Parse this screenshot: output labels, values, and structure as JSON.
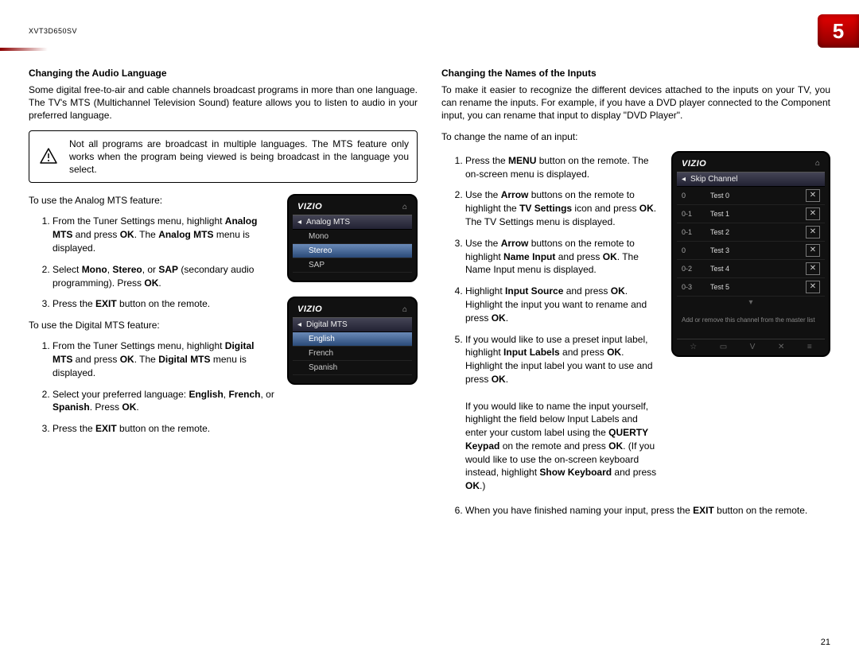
{
  "header": {
    "model": "XVT3D650SV",
    "chapter_number": "5",
    "page_number": "21"
  },
  "left": {
    "h": "Changing the Audio Language",
    "intro": "Some digital free-to-air and cable channels broadcast programs in more than one language. The TV's MTS (Multichannel Television Sound) feature allows you to listen to audio in your preferred language.",
    "note": "Not all programs are broadcast in multiple languages. The MTS feature only works when the program being viewed is being broadcast in the language you select.",
    "analog_lead": "To use the Analog MTS feature:",
    "analog_steps": [
      "From the Tuner Settings menu, highlight <b>Analog MTS</b> and press <b>OK</b>. The <b>Analog MTS</b> menu is displayed.",
      "Select <b>Mono</b>, <b>Stereo</b>, or <b>SAP</b> (secondary audio programming). Press <b>OK</b>.",
      "Press the <b>EXIT</b> button on the remote."
    ],
    "digital_lead": "To use the Digital MTS feature:",
    "digital_steps": [
      "From the Tuner Settings menu, highlight <b>Digital MTS</b> and press <b>OK</b>. The <b>Digital MTS</b> menu is displayed.",
      "Select your preferred language: <b>English</b>, <b>French</b>, or <b>Spanish</b>. Press <b>OK</b>.",
      "Press the <b>EXIT</b> button on the remote."
    ],
    "ss1": {
      "brand": "VIZIO",
      "title": "Analog MTS",
      "items": [
        "Mono",
        "Stereo",
        "SAP"
      ],
      "highlight_index": 1
    },
    "ss2": {
      "brand": "VIZIO",
      "title": "Digital MTS",
      "items": [
        "English",
        "French",
        "Spanish"
      ],
      "highlight_index": 0
    }
  },
  "right": {
    "h": "Changing the Names of the Inputs",
    "intro": "To make it easier to recognize the different devices attached to the inputs on your TV, you can rename the inputs. For example, if you have a DVD player connected to the Component input, you can rename that input to display \"DVD Player\".",
    "lead": "To change the name of an input:",
    "steps": [
      "Press the <b>MENU</b> button on the remote. The on-screen menu is displayed.",
      "Use the <b>Arrow</b> buttons on the remote to highlight the <b>TV Settings</b> icon and press <b>OK</b>. The TV Settings menu is displayed.",
      "Use the <b>Arrow</b> buttons on the remote to highlight <b>Name Input</b> and press <b>OK</b>. The Name Input menu is displayed.",
      "Highlight <b>Input Source</b> and press <b>OK</b>. Highlight the input you want to rename and press <b>OK</b>.",
      "If you would like to use a preset input label, highlight <b>Input Labels</b> and press <b>OK</b>. Highlight the input label you want to use and press <b>OK</b>.<br><br>If you would like to name the input yourself, highlight the field below Input Labels and enter your custom label using the <b>QUERTY Keypad</b> on the remote and press <b>OK</b>. (If you would like to use the on-screen keyboard instead, highlight <b>Show Keyboard</b> and press <b>OK</b>.)",
      "When you have finished naming your input, press the <b>EXIT</b> button on the remote."
    ],
    "ss": {
      "brand": "VIZIO",
      "title": "Skip Channel",
      "rows": [
        {
          "a": "0",
          "b": "Test 0"
        },
        {
          "a": "0-1",
          "b": "Test 1"
        },
        {
          "a": "0-1",
          "b": "Test 2"
        },
        {
          "a": "0",
          "b": "Test 3"
        },
        {
          "a": "0-2",
          "b": "Test 4"
        },
        {
          "a": "0-3",
          "b": "Test 5"
        }
      ],
      "hint": "Add or remove this channel from the master list"
    }
  }
}
